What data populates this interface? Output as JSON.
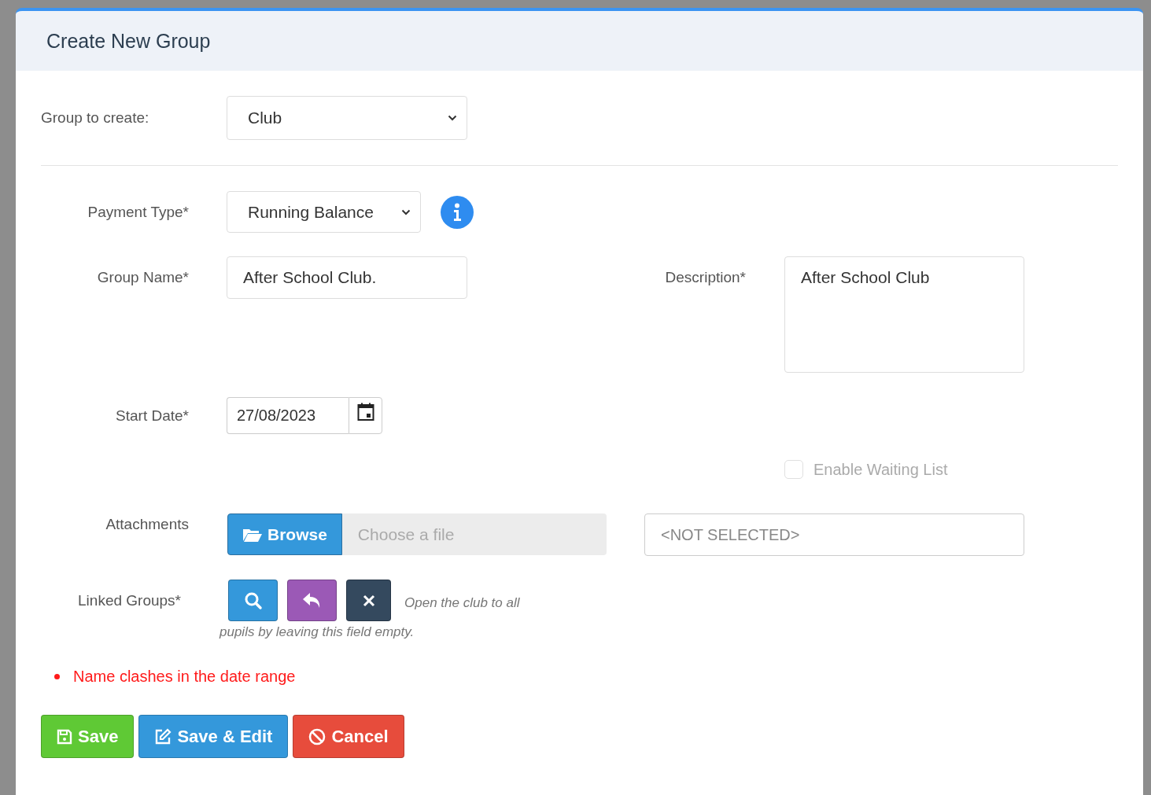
{
  "dialog": {
    "title": "Create New Group"
  },
  "group_to_create": {
    "label": "Group to create:",
    "value": "Club"
  },
  "payment_type": {
    "label": "Payment Type*",
    "value": "Running Balance"
  },
  "group_name": {
    "label": "Group Name*",
    "value": "After School Club."
  },
  "description": {
    "label": "Description*",
    "value": "After School Club"
  },
  "start_date": {
    "label": "Start Date*",
    "value": "27/08/2023"
  },
  "waiting_list": {
    "label": "Enable Waiting List",
    "checked": false,
    "disabled": true
  },
  "attachments": {
    "label": "Attachments",
    "browse": "Browse",
    "placeholder": "Choose a file",
    "selection": "<NOT SELECTED>"
  },
  "linked_groups": {
    "label": "Linked Groups*",
    "help_lines": [
      "Open the club to all",
      "pupils by leaving this field empty."
    ]
  },
  "errors": [
    "Name clashes in the date range"
  ],
  "actions": [
    {
      "kind": "save",
      "label": "Save"
    },
    {
      "kind": "save-edit",
      "label": "Save & Edit"
    },
    {
      "kind": "cancel",
      "label": "Cancel"
    }
  ]
}
